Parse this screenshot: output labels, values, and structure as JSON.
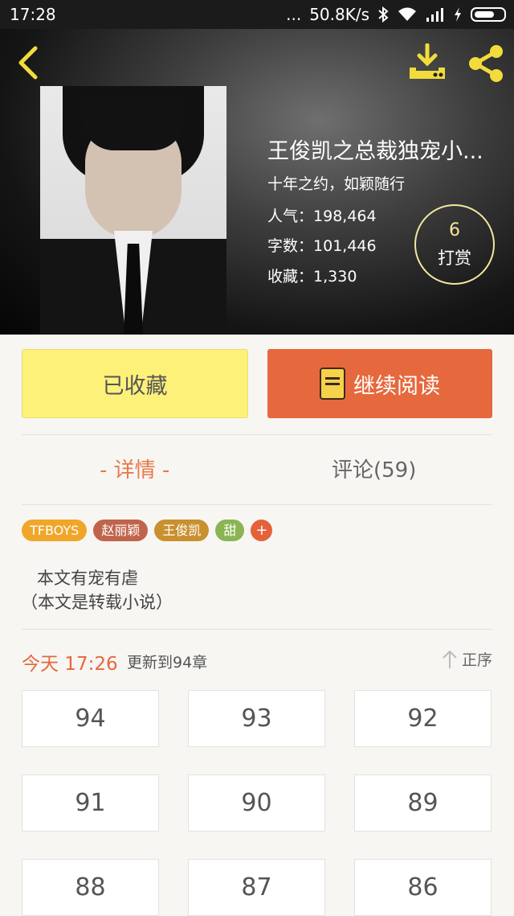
{
  "status_bar": {
    "time": "17:28",
    "dots": "...",
    "speed": "50.8K/s"
  },
  "book": {
    "title": "王俊凯之总裁独宠小...",
    "subtitle": "十年之约，如颖随行",
    "stats": [
      {
        "label": "人气",
        "value": "198,464"
      },
      {
        "label": "字数",
        "value": "101,446"
      },
      {
        "label": "收藏",
        "value": "1,330"
      }
    ],
    "tip": {
      "count": "6",
      "label": "打赏"
    }
  },
  "actions": {
    "favorite_label": "已收藏",
    "read_label": "继续阅读"
  },
  "tabs": {
    "detail": "- 详情 -",
    "comments": "评论(59)"
  },
  "tags": [
    {
      "label": "TFBOYS",
      "color": "#f0a629"
    },
    {
      "label": "赵丽颖",
      "color": "#c0644a"
    },
    {
      "label": "王俊凯",
      "color": "#c9902f"
    },
    {
      "label": "甜",
      "color": "#8bb453"
    },
    {
      "label": "+",
      "color": "#e5613a"
    }
  ],
  "description": {
    "line1": "本文有宠有虐",
    "line2": "（本文是转载小说）"
  },
  "update": {
    "today": "今天 17:26",
    "text": "更新到94章",
    "order_label": "正序"
  },
  "chapters": [
    "94",
    "93",
    "92",
    "91",
    "90",
    "89",
    "88",
    "87",
    "86"
  ],
  "colors": {
    "accent": "#e6683d",
    "favorite_bg": "#fdf17a"
  }
}
